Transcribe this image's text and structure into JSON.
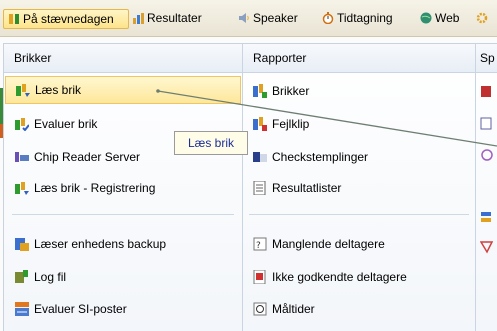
{
  "topbar": {
    "tabs": [
      {
        "label": "På stævnedagen",
        "icon": "runners-icon"
      },
      {
        "label": "Resultater",
        "icon": "results-icon"
      },
      {
        "label": "Speaker",
        "icon": "speaker-icon"
      },
      {
        "label": "Tidtagning",
        "icon": "stopwatch-icon"
      },
      {
        "label": "Web",
        "icon": "globe-icon"
      }
    ]
  },
  "columns": {
    "brikker": {
      "header": "Brikker",
      "items": [
        {
          "label": "Læs brik"
        },
        {
          "label": "Evaluer brik"
        },
        {
          "label": "Chip Reader Server"
        },
        {
          "label": "Læs brik - Registrering"
        },
        {
          "label": "Læser enhedens backup"
        },
        {
          "label": "Log fil"
        },
        {
          "label": "Evaluer SI-poster"
        }
      ]
    },
    "rapporter": {
      "header": "Rapporter",
      "items": [
        {
          "label": "Brikker"
        },
        {
          "label": "Fejlklip"
        },
        {
          "label": "Checkstemplinger"
        },
        {
          "label": "Resultatlister"
        },
        {
          "label": "Manglende deltagere"
        },
        {
          "label": "Ikke godkendte deltagere"
        },
        {
          "label": "Måltider"
        }
      ]
    },
    "third": {
      "header": "Sp"
    }
  },
  "tooltip": {
    "text": "Læs brik"
  },
  "colors": {
    "accent": "#fde38b",
    "tooltip_text": "#1b2f9b"
  }
}
